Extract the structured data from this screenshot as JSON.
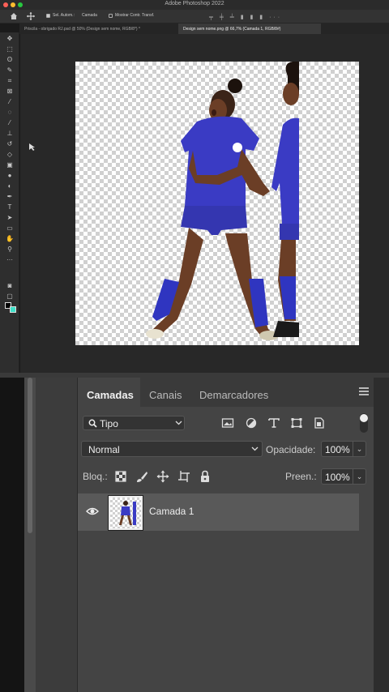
{
  "app": {
    "title": "Adobe Photoshop 2022"
  },
  "options_bar": {
    "auto_select_label": "Sel. Autom.:",
    "auto_select_value": "Camada",
    "show_transform_label": "Mostrar Contr. Transf."
  },
  "document_tabs": [
    {
      "label": "Priscila - obrigado RJ.psd @ 50% (Design sem nome, RGB/8*) *",
      "active": false
    },
    {
      "label": "Design sem nome.png @ 66,7% (Camada 1, RGB/8#)",
      "active": true
    }
  ],
  "tools": [
    "move",
    "marquee",
    "lasso",
    "quick-select",
    "crop",
    "frame",
    "eyedropper",
    "spot-heal",
    "brush",
    "stamp",
    "history-brush",
    "eraser",
    "gradient",
    "blur",
    "dodge",
    "pen",
    "type",
    "path-select",
    "rectangle",
    "hand",
    "zoom",
    "more"
  ],
  "colors": {
    "foreground": "#000000",
    "background": "#3fe0c8",
    "jersey": "#3a3bc4"
  },
  "layers_panel": {
    "tabs": [
      {
        "label": "Camadas",
        "active": true
      },
      {
        "label": "Canais",
        "active": false
      },
      {
        "label": "Demarcadores",
        "active": false
      }
    ],
    "filter_label": "Tipo",
    "blend_mode": "Normal",
    "opacity_label": "Opacidade:",
    "opacity_value": "100%",
    "lock_label": "Bloq.:",
    "fill_label": "Preen.:",
    "fill_value": "100%",
    "layers": [
      {
        "name": "Camada 1",
        "visible": true
      }
    ]
  }
}
